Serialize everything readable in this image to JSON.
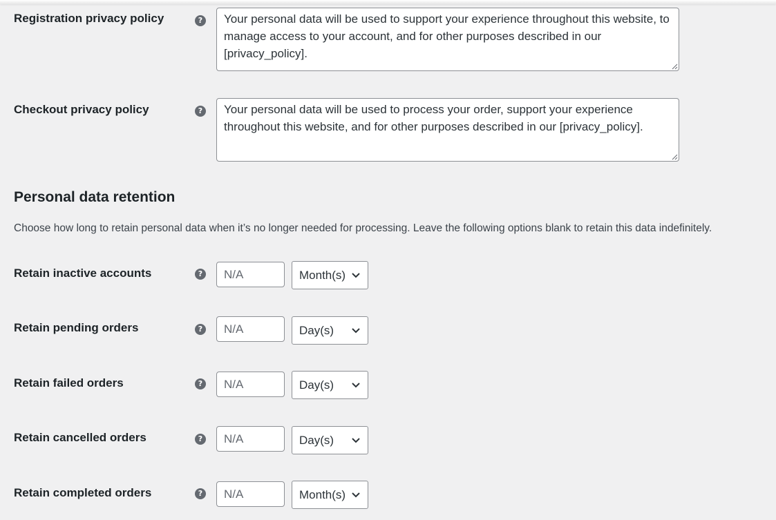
{
  "privacy": {
    "registration": {
      "label": "Registration privacy policy",
      "text": "Your personal data will be used to support your experience throughout this website, to manage access to your account, and for other purposes described in our [privacy_policy]."
    },
    "checkout": {
      "label": "Checkout privacy policy",
      "text": "Your personal data will be used to process your order, support your experience throughout this website, and for other purposes described in our [privacy_policy]."
    }
  },
  "retention": {
    "title": "Personal data retention",
    "description": "Choose how long to retain personal data when it’s no longer needed for processing. Leave the following options blank to retain this data indefinitely.",
    "rows": [
      {
        "label": "Retain inactive accounts",
        "placeholder": "N/A",
        "unit": "Month(s)"
      },
      {
        "label": "Retain pending orders",
        "placeholder": "N/A",
        "unit": "Day(s)"
      },
      {
        "label": "Retain failed orders",
        "placeholder": "N/A",
        "unit": "Day(s)"
      },
      {
        "label": "Retain cancelled orders",
        "placeholder": "N/A",
        "unit": "Day(s)"
      },
      {
        "label": "Retain completed orders",
        "placeholder": "N/A",
        "unit": "Month(s)"
      }
    ]
  },
  "help_glyph": "?",
  "icons": {
    "help": "help-icon",
    "chevron": "chevron-down-icon",
    "grip": "resize-grip-icon"
  }
}
